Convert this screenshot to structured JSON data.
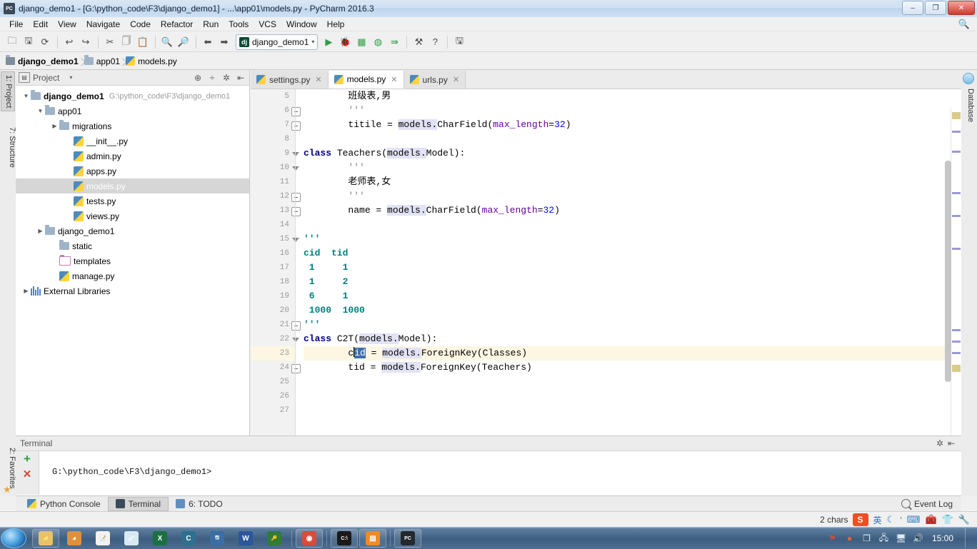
{
  "window": {
    "title": "django_demo1 - [G:\\python_code\\F3\\django_demo1] - ...\\app01\\models.py - PyCharm 2016.3",
    "app_icon": "pycharm-icon",
    "minimize": "–",
    "maximize": "❐",
    "close": "✕"
  },
  "menubar": {
    "items": [
      "File",
      "Edit",
      "View",
      "Navigate",
      "Code",
      "Refactor",
      "Run",
      "Tools",
      "VCS",
      "Window",
      "Help"
    ],
    "search_icon": "search-icon"
  },
  "toolbar": {
    "buttons": [
      {
        "name": "open-folder-icon",
        "glyph": "🗀"
      },
      {
        "name": "save-all-icon",
        "glyph": "🖫"
      },
      {
        "name": "sync-icon",
        "glyph": "⟳"
      },
      {
        "name": "undo-icon",
        "glyph": "↩"
      },
      {
        "name": "redo-icon",
        "glyph": "↪"
      },
      {
        "name": "cut-icon",
        "glyph": "✂"
      },
      {
        "name": "copy-icon",
        "glyph": "🗍"
      },
      {
        "name": "paste-icon",
        "glyph": "📋"
      },
      {
        "name": "find-icon",
        "glyph": "🔍"
      },
      {
        "name": "replace-icon",
        "glyph": "🔎"
      },
      {
        "name": "back-icon",
        "glyph": "⬅"
      },
      {
        "name": "forward-icon",
        "glyph": "➡"
      }
    ],
    "run_config": {
      "label": "django_demo1",
      "icon": "django-icon",
      "caret": "▾"
    },
    "right_buttons": [
      {
        "name": "run-icon",
        "glyph": "▶"
      },
      {
        "name": "debug-icon",
        "glyph": "🐞"
      },
      {
        "name": "coverage-icon",
        "glyph": "▦"
      },
      {
        "name": "profile-icon",
        "glyph": "◍"
      },
      {
        "name": "run-with-console-icon",
        "glyph": "⇛"
      },
      {
        "name": "settings-wrench-icon",
        "glyph": "⚒"
      },
      {
        "name": "help-icon",
        "glyph": "?"
      },
      {
        "name": "database-toolbar-icon",
        "glyph": "🖫"
      }
    ]
  },
  "breadcrumb": [
    {
      "label": "django_demo1",
      "icon": "folder-icon",
      "bold": true
    },
    {
      "label": "app01",
      "icon": "folder-icon",
      "bold": false
    },
    {
      "label": "models.py",
      "icon": "python-file-icon",
      "bold": false
    }
  ],
  "left_strip": {
    "tabs": [
      {
        "label": "1: Project",
        "active": true
      },
      {
        "label": "7: Structure",
        "active": false
      }
    ],
    "favorites": {
      "label": "2: Favorites",
      "icon": "star-icon"
    }
  },
  "right_strip": {
    "tabs": [
      {
        "label": "Database",
        "icon": "database-icon"
      }
    ]
  },
  "project_panel": {
    "title": "Project",
    "panel_icon": "project-view-icon",
    "caret": "▾",
    "header_buttons": [
      {
        "name": "target-icon",
        "glyph": "⊕"
      },
      {
        "name": "collapse-all-icon",
        "glyph": "÷"
      },
      {
        "name": "settings-gear-icon",
        "glyph": "✲"
      },
      {
        "name": "hide-panel-icon",
        "glyph": "⇤"
      }
    ],
    "tree": [
      {
        "depth": 0,
        "arrow": "▼",
        "icon": "folder-icon",
        "label": "django_demo1",
        "bold": true,
        "path": "G:\\python_code\\F3\\django_demo1",
        "selected": false
      },
      {
        "depth": 1,
        "arrow": "▼",
        "icon": "folder-icon",
        "label": "app01",
        "bold": false,
        "path": "",
        "selected": false
      },
      {
        "depth": 2,
        "arrow": "▶",
        "icon": "folder-icon",
        "label": "migrations",
        "bold": false,
        "path": "",
        "selected": false
      },
      {
        "depth": 3,
        "arrow": "",
        "icon": "python-file-icon",
        "label": "__init__.py",
        "bold": false,
        "path": "",
        "selected": false
      },
      {
        "depth": 3,
        "arrow": "",
        "icon": "python-file-icon",
        "label": "admin.py",
        "bold": false,
        "path": "",
        "selected": false
      },
      {
        "depth": 3,
        "arrow": "",
        "icon": "python-file-icon",
        "label": "apps.py",
        "bold": false,
        "path": "",
        "selected": false
      },
      {
        "depth": 3,
        "arrow": "",
        "icon": "python-file-icon",
        "label": "models.py",
        "bold": false,
        "path": "",
        "selected": true
      },
      {
        "depth": 3,
        "arrow": "",
        "icon": "python-file-icon",
        "label": "tests.py",
        "bold": false,
        "path": "",
        "selected": false
      },
      {
        "depth": 3,
        "arrow": "",
        "icon": "python-file-icon",
        "label": "views.py",
        "bold": false,
        "path": "",
        "selected": false
      },
      {
        "depth": 1,
        "arrow": "▶",
        "icon": "folder-icon",
        "label": "django_demo1",
        "bold": false,
        "path": "",
        "selected": false
      },
      {
        "depth": 2,
        "arrow": "",
        "icon": "folder-icon",
        "label": "static",
        "bold": false,
        "path": "",
        "selected": false
      },
      {
        "depth": 2,
        "arrow": "",
        "icon": "templates-folder-icon",
        "label": "templates",
        "bold": false,
        "path": "",
        "selected": false
      },
      {
        "depth": 2,
        "arrow": "",
        "icon": "python-file-icon",
        "label": "manage.py",
        "bold": false,
        "path": "",
        "selected": false
      },
      {
        "depth": 0,
        "arrow": "▶",
        "icon": "library-icon",
        "label": "External Libraries",
        "bold": false,
        "path": "",
        "selected": false
      }
    ]
  },
  "editor": {
    "tabs": [
      {
        "label": "settings.py",
        "icon": "python-file-icon",
        "close": "✕",
        "active": false
      },
      {
        "label": "models.py",
        "icon": "python-file-icon",
        "close": "✕",
        "active": true
      },
      {
        "label": "urls.py",
        "icon": "python-file-icon",
        "close": "✕",
        "active": false
      }
    ],
    "first_line_number": 5,
    "lines": [
      {
        "n": 5,
        "fold": "",
        "html": "        班级表,男",
        "hl": false
      },
      {
        "n": 6,
        "fold": "minus",
        "html": "        <span class=\"cmt\">'''</span>",
        "hl": false
      },
      {
        "n": 7,
        "fold": "minus",
        "html": "        titile = <span class=\"mod\">models.</span>CharField(<span class=\"kwarg\">max_length</span>=<span class=\"num\">32</span>)",
        "hl": false
      },
      {
        "n": 8,
        "fold": "",
        "html": "",
        "hl": false
      },
      {
        "n": 9,
        "fold": "tri",
        "html": "<span class=\"kw\">class</span> Teachers(<span class=\"mod\">models.</span>Model):",
        "hl": false
      },
      {
        "n": 10,
        "fold": "tri",
        "html": "        <span class=\"cmt\">'''</span>",
        "hl": false
      },
      {
        "n": 11,
        "fold": "",
        "html": "        老师表,女",
        "hl": false
      },
      {
        "n": 12,
        "fold": "minus",
        "html": "        <span class=\"cmt\">'''</span>",
        "hl": false
      },
      {
        "n": 13,
        "fold": "minus",
        "html": "        name = <span class=\"mod\">models.</span>CharField(<span class=\"kwarg\">max_length</span>=<span class=\"num\">32</span>)",
        "hl": false
      },
      {
        "n": 14,
        "fold": "",
        "html": "",
        "hl": false
      },
      {
        "n": 15,
        "fold": "tri",
        "html": "<span class=\"str\">'''</span>",
        "hl": false
      },
      {
        "n": 16,
        "fold": "",
        "html": "<span class=\"str\">cid  tid</span>",
        "hl": false
      },
      {
        "n": 17,
        "fold": "",
        "html": "<span class=\"str\"> 1     1</span>",
        "hl": false
      },
      {
        "n": 18,
        "fold": "",
        "html": "<span class=\"str\"> 1     2</span>",
        "hl": false
      },
      {
        "n": 19,
        "fold": "",
        "html": "<span class=\"str\"> 6     1</span>",
        "hl": false
      },
      {
        "n": 20,
        "fold": "",
        "html": "<span class=\"str\"> 1000  1000</span>",
        "hl": false
      },
      {
        "n": 21,
        "fold": "minus",
        "html": "<span class=\"str\">'''</span>",
        "hl": false
      },
      {
        "n": 22,
        "fold": "tri",
        "html": "<span class=\"kw\">class</span> C2T(<span class=\"mod\">models.</span>Model):",
        "hl": false
      },
      {
        "n": 23,
        "fold": "",
        "html": "        c<span class=\"caret\"></span><span class=\"sel\">id</span> = <span class=\"mod\">models.</span>ForeignKey(Classes)",
        "hl": true
      },
      {
        "n": 24,
        "fold": "minus",
        "html": "        tid = <span class=\"mod\">models.</span>ForeignKey(Teachers)",
        "hl": false
      },
      {
        "n": 25,
        "fold": "",
        "html": "",
        "hl": false
      },
      {
        "n": 26,
        "fold": "",
        "html": "",
        "hl": false
      },
      {
        "n": 27,
        "fold": "",
        "html": "",
        "hl": false
      }
    ],
    "plain_text": [
      "        班级表,男",
      "        '''",
      "        titile = models.CharField(max_length=32)",
      "",
      "class Teachers(models.Model):",
      "        '''",
      "        老师表,女",
      "        '''",
      "        name = models.CharField(max_length=32)",
      "",
      "'''",
      "cid  tid",
      " 1     1",
      " 1     2",
      " 6     1",
      " 1000  1000",
      "'''",
      "class C2T(models.Model):",
      "        cid = models.ForeignKey(Classes)",
      "        tid = models.ForeignKey(Teachers)",
      "",
      "",
      ""
    ],
    "colors": {
      "keyword": "#000080",
      "string": "#008080",
      "comment": "#808080",
      "kwarg": "#660099",
      "number": "#0000ff",
      "module_highlight": "#e2e2f5",
      "selection": "#3f6ea8",
      "caret_line": "#fdf6e3"
    }
  },
  "terminal": {
    "title": "Terminal",
    "new_session_icon": "plus-icon",
    "close_session_icon": "close-icon",
    "settings_icon": "gear-icon",
    "hide_icon": "hide-panel-icon",
    "prompt": "G:\\python_code\\F3\\django_demo1>"
  },
  "bottom_tabs": [
    {
      "label": "Python Console",
      "icon": "python-console-icon",
      "active": false,
      "prefix": ""
    },
    {
      "label": "Terminal",
      "icon": "terminal-icon",
      "active": true,
      "prefix": ""
    },
    {
      "label": "6: TODO",
      "icon": "todo-icon",
      "active": false,
      "prefix": ""
    }
  ],
  "event_log": {
    "label": "Event Log",
    "icon": "search-icon"
  },
  "statusbar": {
    "chars": "2 chars",
    "ime": {
      "logo": "S",
      "items": [
        {
          "name": "ime-chinese-icon",
          "glyph": "英"
        },
        {
          "name": "ime-moon-icon",
          "glyph": "☾"
        },
        {
          "name": "ime-punct-icon",
          "glyph": "'"
        },
        {
          "name": "ime-keyboard-icon",
          "glyph": "⌨"
        },
        {
          "name": "ime-toolbox-icon",
          "glyph": "🧰"
        },
        {
          "name": "ime-skin-icon",
          "glyph": "👕"
        },
        {
          "name": "ime-settings-icon",
          "glyph": "🔧"
        }
      ]
    }
  },
  "taskbar": {
    "start": "start-orb",
    "apps": [
      {
        "name": "explorer-icon",
        "glyph": "📁",
        "color": "#e8c26a"
      },
      {
        "name": "media-player-icon",
        "glyph": "◕",
        "color": "#e0903c"
      },
      {
        "name": "notepad-icon",
        "glyph": "📝",
        "color": "#f2f2f2"
      },
      {
        "name": "paint-icon",
        "glyph": "🖌",
        "color": "#d8e8f4"
      },
      {
        "name": "excel-icon",
        "glyph": "X",
        "color": "#1d6f42"
      },
      {
        "name": "c-icon",
        "glyph": "C",
        "color": "#2f6f8f"
      },
      {
        "name": "save-icon",
        "glyph": "🖫",
        "color": "#3a6ea5"
      },
      {
        "name": "word-icon",
        "glyph": "W",
        "color": "#2b579a"
      },
      {
        "name": "keepass-icon",
        "glyph": "🔑",
        "color": "#2f7d32"
      },
      {
        "name": "chrome-icon",
        "glyph": "◉",
        "color": "#d94b3c"
      },
      {
        "name": "cmd-icon",
        "glyph": "C:\\",
        "color": "#1a1a1a"
      },
      {
        "name": "app-orange-icon",
        "glyph": "▤",
        "color": "#f08a24"
      },
      {
        "name": "pycharm-icon",
        "glyph": "PC",
        "color": "#24292e"
      }
    ],
    "tray": [
      {
        "name": "tray-red-icon",
        "glyph": "⚑"
      },
      {
        "name": "tray-orange-icon",
        "glyph": "●"
      },
      {
        "name": "tray-window-icon",
        "glyph": "❐"
      },
      {
        "name": "tray-network-icon",
        "glyph": "🖧"
      },
      {
        "name": "tray-monitor-icon",
        "glyph": "🖥"
      },
      {
        "name": "tray-volume-icon",
        "glyph": "🔊"
      }
    ],
    "clock": "15:00"
  }
}
